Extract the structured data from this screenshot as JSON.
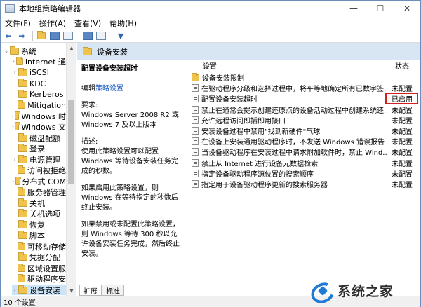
{
  "window": {
    "title": "本地组策略编辑器",
    "controls": {
      "minimize": "—",
      "maximize": "☐",
      "close": "✕"
    }
  },
  "menu": [
    "文件(F)",
    "操作(A)",
    "查看(V)",
    "帮助(H)"
  ],
  "toolbar": {
    "icons": [
      "back-arrow-icon",
      "forward-arrow-icon",
      "up-folder-icon",
      "show-hide-tree-icon",
      "export-list-icon",
      "help-icon",
      "properties-icon",
      "filter-icon"
    ],
    "back": "⬅",
    "forward": "➡",
    "filter": "▼"
  },
  "tree": {
    "items": [
      {
        "label": "系统",
        "indent": 0,
        "arrow": "⌄"
      },
      {
        "label": "Internet 通",
        "indent": 1,
        "arrow": "›"
      },
      {
        "label": "iSCSI",
        "indent": 1,
        "arrow": "›"
      },
      {
        "label": "KDC",
        "indent": 1,
        "arrow": ""
      },
      {
        "label": "Kerberos",
        "indent": 1,
        "arrow": ""
      },
      {
        "label": "Mitigation",
        "indent": 1,
        "arrow": ""
      },
      {
        "label": "Windows 时",
        "indent": 1,
        "arrow": "›"
      },
      {
        "label": "Windows 文",
        "indent": 1,
        "arrow": "›"
      },
      {
        "label": "磁盘配额",
        "indent": 1,
        "arrow": ""
      },
      {
        "label": "登录",
        "indent": 1,
        "arrow": ""
      },
      {
        "label": "电源管理",
        "indent": 1,
        "arrow": "›"
      },
      {
        "label": "访问被拒绝",
        "indent": 1,
        "arrow": ""
      },
      {
        "label": "分布式 COM",
        "indent": 1,
        "arrow": "›"
      },
      {
        "label": "服务器管理",
        "indent": 1,
        "arrow": ""
      },
      {
        "label": "关机",
        "indent": 1,
        "arrow": ""
      },
      {
        "label": "关机选项",
        "indent": 1,
        "arrow": ""
      },
      {
        "label": "恢复",
        "indent": 1,
        "arrow": ""
      },
      {
        "label": "脚本",
        "indent": 1,
        "arrow": ""
      },
      {
        "label": "可移动存储",
        "indent": 1,
        "arrow": ""
      },
      {
        "label": "凭据分配",
        "indent": 1,
        "arrow": ""
      },
      {
        "label": "区域设置服",
        "indent": 1,
        "arrow": ""
      },
      {
        "label": "驱动程序安",
        "indent": 1,
        "arrow": ""
      },
      {
        "label": "设备安装",
        "indent": 1,
        "arrow": "›",
        "selected": true
      }
    ]
  },
  "header": {
    "title": "设备安装"
  },
  "description": {
    "title": "配置设备安装超时",
    "edit_prefix": "编辑",
    "edit_link": "策略设置",
    "requirements_label": "要求:",
    "requirements_text": "Windows Server 2008 R2 或 Windows 7 及以上版本",
    "description_label": "描述:",
    "description_text": "使用此策略设置可以配置 Windows 等待设备安装任务完成的秒数。",
    "enabled_text": "如果启用此策略设置，则 Windows 在等待指定的秒数后终止安装。",
    "disabled_text": "如果禁用或未配置此策略设置，则 Windows 等待 300 秒以允许设备安装任务完成，然后终止安装。"
  },
  "list": {
    "col_setting": "设置",
    "col_state": "状态",
    "rows": [
      {
        "name": "设备安装限制",
        "state": "",
        "type": "folder"
      },
      {
        "name": "在驱动程序分级和选择过程中，将平等地确定所有已数字签...",
        "state": "未配置",
        "type": "setting"
      },
      {
        "name": "配置设备安装超时",
        "state": "已启用",
        "type": "setting"
      },
      {
        "name": "禁止在通常会提示创建还原点的设备活动过程中创建系统还...",
        "state": "未配置",
        "type": "setting"
      },
      {
        "name": "允许远程访问即插即用接口",
        "state": "未配置",
        "type": "setting"
      },
      {
        "name": "安装设备过程中禁用\"找到新硬件\"气球",
        "state": "未配置",
        "type": "setting"
      },
      {
        "name": "在设备上安装通用驱动程序时，不发送 Windows 错误报告",
        "state": "未配置",
        "type": "setting"
      },
      {
        "name": "当设备驱动程序在安装过程中请求附加软件时，禁止 Wind...",
        "state": "未配置",
        "type": "setting"
      },
      {
        "name": "禁止从 Internet 进行设备元数据检索",
        "state": "未配置",
        "type": "setting"
      },
      {
        "name": "指定设备驱动程序源位置的搜索顺序",
        "state": "未配置",
        "type": "setting"
      },
      {
        "name": "指定用于设备驱动程序更新的搜索服务器",
        "state": "未配置",
        "type": "setting"
      }
    ],
    "highlight_color": "#d22020"
  },
  "tabs": [
    "扩展",
    "标准"
  ],
  "status": {
    "text": "10 个设置"
  },
  "watermark": {
    "text": "系统之家"
  }
}
